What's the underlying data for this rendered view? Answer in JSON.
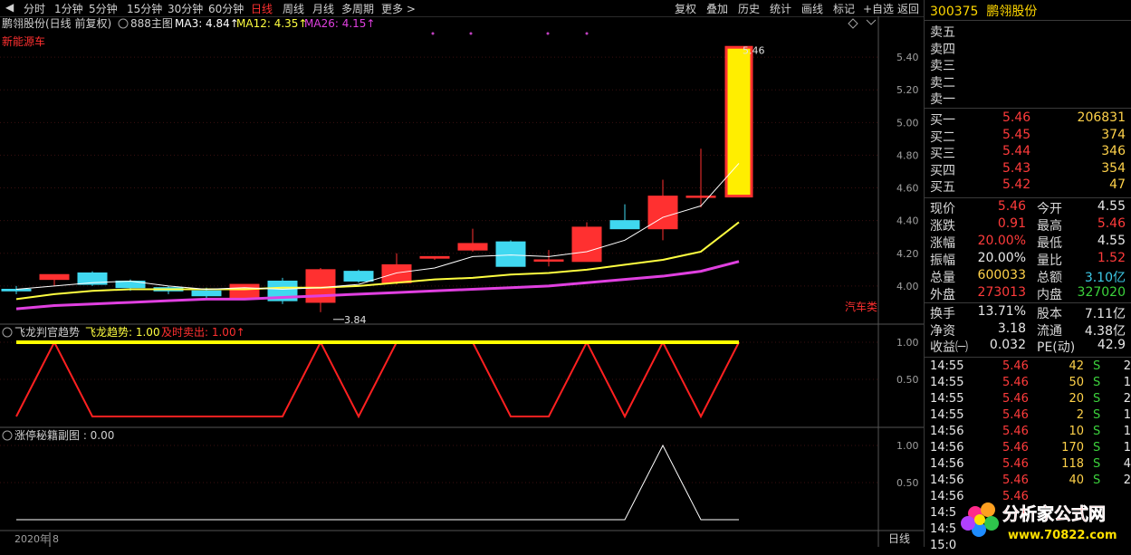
{
  "toolbar": {
    "left_items": [
      "分时",
      "1分钟",
      "5分钟",
      "15分钟",
      "30分钟",
      "60分钟",
      "日线",
      "周线",
      "月线",
      "多周期",
      "更多 >"
    ],
    "active": "日线",
    "right_items": [
      "复权",
      "叠加",
      "历史",
      "统计",
      "画线",
      "标记",
      "+自选",
      "返回"
    ]
  },
  "main_panel": {
    "title": "鹏翎股份(日线 前复权)",
    "template": "888主图",
    "ma3_label": "MA3: 4.84↑",
    "ma12_label": "MA12: 4.35↑",
    "ma26_label": "MA26: 4.15↑",
    "sector": "新能源车",
    "sector2": "汽车类",
    "high_label": "5.46",
    "low_label": "3.84",
    "y_ticks": [
      "5.40",
      "5.20",
      "5.00",
      "4.80",
      "4.60",
      "4.40",
      "4.20",
      "4.00"
    ]
  },
  "panel2": {
    "title": "飞龙判官趋势",
    "label1": "飞龙趋势: 1.00",
    "label2": "及时卖出: 1.00↑",
    "y_ticks": [
      "1.00",
      "0.50"
    ]
  },
  "panel3": {
    "title": "涨停秘籍副图 : 0.00",
    "y_ticks": [
      "1.00",
      "0.50"
    ]
  },
  "footer": {
    "date": "2020年",
    "mark": "8",
    "period": "日线"
  },
  "colors": {
    "up": "#ff3030",
    "down": "#40d8f0",
    "ma3": "#ffffff",
    "ma12": "#ffff40",
    "ma26": "#e040e0",
    "trend_line": "#ffff00",
    "sell_line": "#ff2020"
  },
  "chart_data": {
    "type": "candlestick",
    "candles": [
      {
        "o": 3.98,
        "h": 4.0,
        "l": 3.95,
        "c": 3.97
      },
      {
        "o": 4.04,
        "h": 4.07,
        "l": 4.0,
        "c": 4.07
      },
      {
        "o": 4.08,
        "h": 4.09,
        "l": 4.0,
        "c": 4.01
      },
      {
        "o": 4.03,
        "h": 4.04,
        "l": 3.97,
        "c": 3.99
      },
      {
        "o": 3.99,
        "h": 4.0,
        "l": 3.95,
        "c": 3.97
      },
      {
        "o": 3.97,
        "h": 3.99,
        "l": 3.92,
        "c": 3.94
      },
      {
        "o": 3.93,
        "h": 4.01,
        "l": 3.92,
        "c": 4.01
      },
      {
        "o": 4.03,
        "h": 4.05,
        "l": 3.89,
        "c": 3.91
      },
      {
        "o": 3.9,
        "h": 4.11,
        "l": 3.84,
        "c": 4.1
      },
      {
        "o": 4.09,
        "h": 4.1,
        "l": 4.02,
        "c": 4.03
      },
      {
        "o": 4.02,
        "h": 4.2,
        "l": 4.01,
        "c": 4.13
      },
      {
        "o": 4.17,
        "h": 4.18,
        "l": 4.16,
        "c": 4.18
      },
      {
        "o": 4.22,
        "h": 4.35,
        "l": 4.21,
        "c": 4.26
      },
      {
        "o": 4.27,
        "h": 4.28,
        "l": 4.12,
        "c": 4.12
      },
      {
        "o": 4.16,
        "h": 4.22,
        "l": 4.12,
        "c": 4.16
      },
      {
        "o": 4.15,
        "h": 4.39,
        "l": 4.15,
        "c": 4.36
      },
      {
        "o": 4.4,
        "h": 4.5,
        "l": 4.35,
        "c": 4.35
      },
      {
        "o": 4.35,
        "h": 4.65,
        "l": 4.28,
        "c": 4.55
      },
      {
        "o": 4.55,
        "h": 4.84,
        "l": 4.48,
        "c": 4.55
      },
      {
        "o": 4.55,
        "h": 5.46,
        "l": 4.55,
        "c": 5.46
      }
    ],
    "ma3": [
      3.98,
      4.0,
      4.02,
      4.03,
      4.0,
      3.98,
      3.99,
      3.98,
      3.99,
      4.01,
      4.08,
      4.11,
      4.18,
      4.19,
      4.18,
      4.21,
      4.28,
      4.42,
      4.49,
      4.75
    ],
    "ma12": [
      3.92,
      3.95,
      3.97,
      3.98,
      3.98,
      3.98,
      3.98,
      3.99,
      3.99,
      4.0,
      4.02,
      4.04,
      4.05,
      4.07,
      4.08,
      4.1,
      4.13,
      4.16,
      4.21,
      4.39
    ],
    "ma26": [
      3.86,
      3.88,
      3.89,
      3.9,
      3.91,
      3.92,
      3.92,
      3.93,
      3.94,
      3.95,
      3.96,
      3.97,
      3.98,
      3.99,
      4.0,
      4.02,
      4.04,
      4.06,
      4.09,
      4.15
    ],
    "ylim": [
      3.8,
      5.55
    ],
    "trend": [
      1,
      1,
      1,
      1,
      1,
      1,
      1,
      1,
      1,
      1,
      1,
      1,
      1,
      1,
      1,
      1,
      1,
      1,
      1,
      1
    ],
    "sell": [
      0,
      1,
      0,
      0,
      0,
      0,
      0,
      0,
      1,
      0,
      1,
      1,
      1,
      0,
      0,
      1,
      0,
      1,
      0,
      1
    ],
    "sub2": [
      0,
      0,
      0,
      0,
      0,
      0,
      0,
      0,
      0,
      0,
      0,
      0,
      0,
      0,
      0,
      0,
      0,
      1,
      0,
      0
    ]
  },
  "quote": {
    "code": "300375",
    "name": "鹏翎股份",
    "asks": [
      {
        "label": "卖五",
        "price": "",
        "vol": ""
      },
      {
        "label": "卖四",
        "price": "",
        "vol": ""
      },
      {
        "label": "卖三",
        "price": "",
        "vol": ""
      },
      {
        "label": "卖二",
        "price": "",
        "vol": ""
      },
      {
        "label": "卖一",
        "price": "",
        "vol": ""
      }
    ],
    "bids": [
      {
        "label": "买一",
        "price": "5.46",
        "vol": "206831"
      },
      {
        "label": "买二",
        "price": "5.45",
        "vol": "374"
      },
      {
        "label": "买三",
        "price": "5.44",
        "vol": "346"
      },
      {
        "label": "买四",
        "price": "5.43",
        "vol": "354"
      },
      {
        "label": "买五",
        "price": "5.42",
        "vol": "47"
      }
    ],
    "stats": [
      {
        "l1": "现价",
        "v1": "5.46",
        "c1": "red",
        "l2": "今开",
        "v2": "4.55",
        "c2": "wht"
      },
      {
        "l1": "涨跌",
        "v1": "0.91",
        "c1": "red",
        "l2": "最高",
        "v2": "5.46",
        "c2": "red"
      },
      {
        "l1": "涨幅",
        "v1": "20.00%",
        "c1": "red",
        "l2": "最低",
        "v2": "4.55",
        "c2": "wht"
      },
      {
        "l1": "振幅",
        "v1": "20.00%",
        "c1": "wht",
        "l2": "量比",
        "v2": "1.52",
        "c2": "red"
      },
      {
        "l1": "总量",
        "v1": "600033",
        "c1": "yel",
        "l2": "总额",
        "v2": "3.10亿",
        "c2": "cyan"
      },
      {
        "l1": "外盘",
        "v1": "273013",
        "c1": "red",
        "l2": "内盘",
        "v2": "327020",
        "c2": "grn"
      }
    ],
    "fund": [
      {
        "l1": "换手",
        "v1": "13.71%",
        "l2": "股本",
        "v2": "7.11亿"
      },
      {
        "l1": "净资",
        "v1": "3.18",
        "l2": "流通",
        "v2": "4.38亿"
      },
      {
        "l1": "收益㈠",
        "v1": "0.032",
        "l2": "PE(动)",
        "v2": "42.9"
      }
    ],
    "ticks": [
      {
        "t": "14:55",
        "p": "5.46",
        "v": "42",
        "s": "S",
        "n": "2"
      },
      {
        "t": "14:55",
        "p": "5.46",
        "v": "50",
        "s": "S",
        "n": "1"
      },
      {
        "t": "14:55",
        "p": "5.46",
        "v": "20",
        "s": "S",
        "n": "2"
      },
      {
        "t": "14:55",
        "p": "5.46",
        "v": "2",
        "s": "S",
        "n": "1"
      },
      {
        "t": "14:56",
        "p": "5.46",
        "v": "10",
        "s": "S",
        "n": "1"
      },
      {
        "t": "14:56",
        "p": "5.46",
        "v": "170",
        "s": "S",
        "n": "1"
      },
      {
        "t": "14:56",
        "p": "5.46",
        "v": "118",
        "s": "S",
        "n": "4"
      },
      {
        "t": "14:56",
        "p": "5.46",
        "v": "40",
        "s": "S",
        "n": "2"
      },
      {
        "t": "14:56",
        "p": "5.46",
        "v": "",
        "s": "",
        "n": ""
      },
      {
        "t": "14:5",
        "p": "",
        "v": "",
        "s": "",
        "n": ""
      },
      {
        "t": "14:5",
        "p": "",
        "v": "",
        "s": "",
        "n": ""
      },
      {
        "t": "15:0",
        "p": "",
        "v": "",
        "s": "",
        "n": ""
      }
    ]
  },
  "watermark": {
    "text": "分析家公式网",
    "url": "www.70822.com"
  }
}
